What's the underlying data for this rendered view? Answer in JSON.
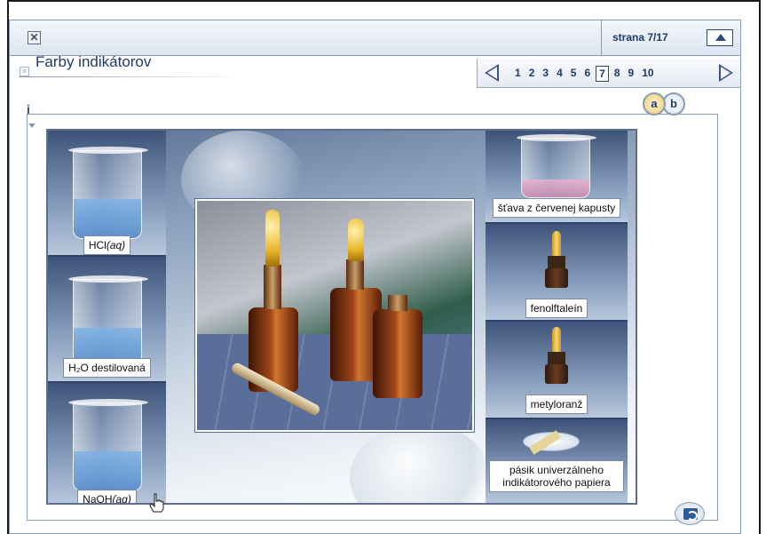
{
  "topbar": {
    "close_icon": "close-icon"
  },
  "pager": {
    "label": "strana 7/17",
    "up_icon": "triangle-up-icon"
  },
  "nav": {
    "prev_icon": "triangle-left-icon",
    "next_icon": "triangle-right-icon",
    "pages": [
      "1",
      "2",
      "3",
      "4",
      "5",
      "6",
      "7",
      "8",
      "9",
      "10"
    ],
    "current_page": "7"
  },
  "section": {
    "title": "Farby indikátorov",
    "close_icon": "close-icon"
  },
  "panel": {
    "info_label": "i",
    "tabs": [
      "a",
      "b"
    ],
    "active_tab": "a"
  },
  "left_items": [
    {
      "label": "HCl",
      "suffix": "(aq)"
    },
    {
      "label": "H₂O destilovaná",
      "suffix": ""
    },
    {
      "label": "NaOH ",
      "suffix": "(aq)"
    }
  ],
  "right_items": [
    {
      "label": "šťava z červenej kapusty"
    },
    {
      "label": "fenolftaleín"
    },
    {
      "label": "metyloranž"
    },
    {
      "label": "pásik univerzálneho indikátorového papiera"
    }
  ],
  "footer": {
    "refresh_icon": "refresh-icon"
  },
  "colors": {
    "accent": "#1f3a6b",
    "border": "#8a9bb8"
  }
}
